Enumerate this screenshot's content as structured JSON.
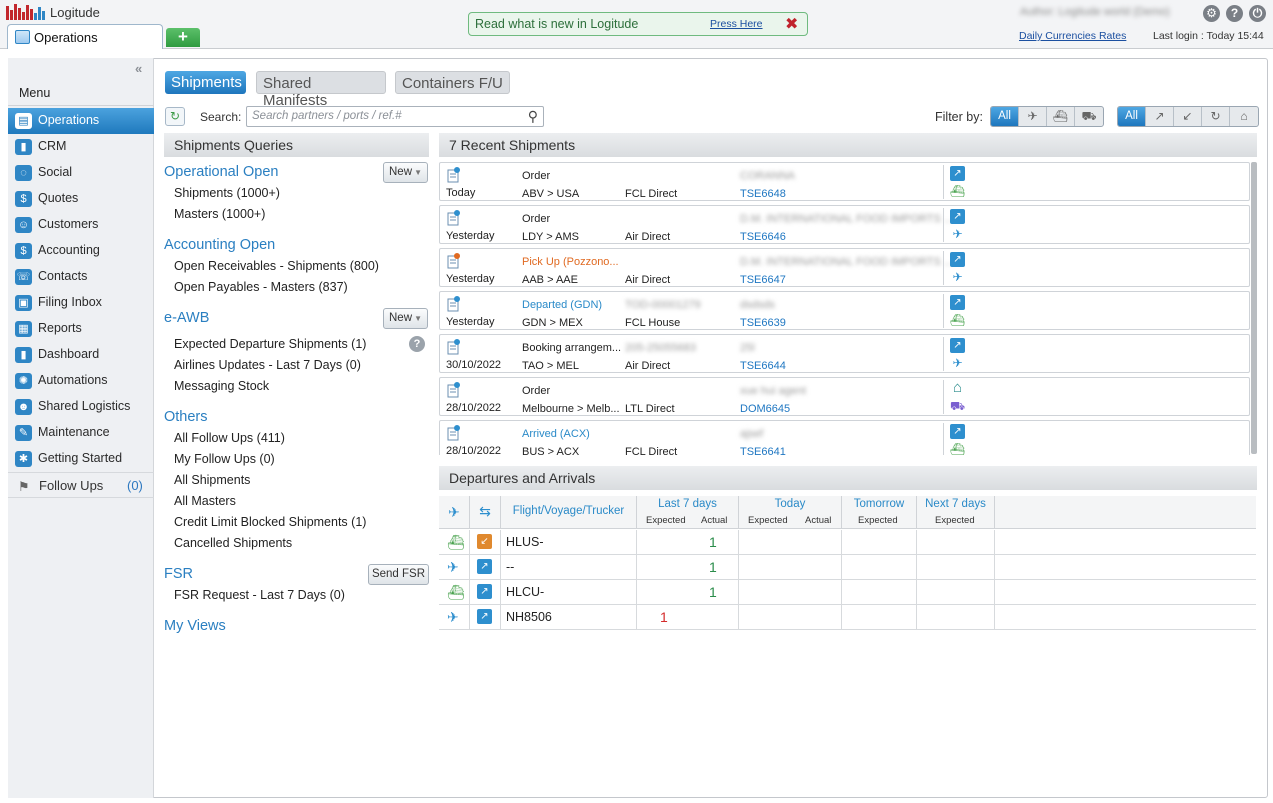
{
  "app": {
    "name": "Logitude",
    "tab": "Operations",
    "add_tab": "+"
  },
  "news": {
    "text": "Read what is new in Logitude",
    "link": "Press Here",
    "close": "✖"
  },
  "header": {
    "author": "Author: Logitude world (Demo)",
    "currencies": "Daily Currencies Rates",
    "last_login": "Last login : Today 15:44",
    "icons": [
      "gear-icon",
      "help-icon",
      "power-icon"
    ]
  },
  "sidebar": {
    "collapse": "«",
    "menu_title": "Menu",
    "items": [
      {
        "label": "Operations",
        "icon": "operations-icon",
        "color": "#2f86c5",
        "active": true
      },
      {
        "label": "CRM",
        "icon": "crm-icon",
        "color": "#2f86c5"
      },
      {
        "label": "Social",
        "icon": "social-icon",
        "color": "#2f86c5"
      },
      {
        "label": "Quotes",
        "icon": "quotes-icon",
        "color": "#2f86c5"
      },
      {
        "label": "Customers",
        "icon": "customers-icon",
        "color": "#2f86c5"
      },
      {
        "label": "Accounting",
        "icon": "accounting-icon",
        "color": "#2f86c5"
      },
      {
        "label": "Contacts",
        "icon": "contacts-icon",
        "color": "#2f86c5"
      },
      {
        "label": "Filing Inbox",
        "icon": "filing-inbox-icon",
        "color": "#2f86c5"
      },
      {
        "label": "Reports",
        "icon": "reports-icon",
        "color": "#2f86c5"
      },
      {
        "label": "Dashboard",
        "icon": "dashboard-icon",
        "color": "#2f86c5"
      },
      {
        "label": "Automations",
        "icon": "automations-icon",
        "color": "#2f86c5"
      },
      {
        "label": "Shared Logistics",
        "icon": "shared-logistics-icon",
        "color": "#2f86c5"
      },
      {
        "label": "Maintenance",
        "icon": "maintenance-icon",
        "color": "#2f86c5"
      },
      {
        "label": "Getting Started",
        "icon": "getting-started-icon",
        "color": "#2f86c5"
      }
    ],
    "follow_ups": {
      "label": "Follow Ups",
      "count": "(0)"
    }
  },
  "main_tabs": [
    "Shipments",
    "Shared Manifests",
    "Containers F/U"
  ],
  "search": {
    "label": "Search:",
    "placeholder": "Search partners / ports / ref.#"
  },
  "filter": {
    "label": "Filter by:",
    "all": "All"
  },
  "queries": {
    "title": "Shipments Queries",
    "new_label": "New",
    "send_fsr": "Send FSR",
    "groups": [
      {
        "title": "Operational Open",
        "items": [
          "Shipments (1000+)",
          "Masters (1000+)"
        ]
      },
      {
        "title": "Accounting Open",
        "items": [
          "Open Receivables - Shipments (800)",
          "Open Payables - Masters (837)"
        ]
      },
      {
        "title": "e-AWB",
        "items": [
          "Expected Departure Shipments (1)",
          "Airlines Updates - Last 7 Days (0)",
          "Messaging Stock"
        ]
      },
      {
        "title": "Others",
        "items": [
          "All Follow Ups (411)",
          "My Follow Ups (0)",
          "All Shipments",
          "All Masters",
          "Credit Limit Blocked Shipments (1)",
          "Cancelled Shipments"
        ]
      },
      {
        "title": "FSR",
        "items": [
          "FSR Request - Last 7 Days (0)"
        ]
      },
      {
        "title": "My Views",
        "items": []
      }
    ]
  },
  "recent": {
    "title": "7 Recent Shipments",
    "items": [
      {
        "date": "Today",
        "status": "Order",
        "status_style": "plain",
        "ref": "",
        "party": "CORANNA",
        "route": "ABV > USA",
        "mode": "FCL Direct",
        "number": "TSE6648",
        "dir": "export",
        "type": "ship"
      },
      {
        "date": "Yesterday",
        "status": "Order",
        "status_style": "plain",
        "ref": "",
        "party": "D.M. INTERNATIONAL FOOD IMPORTS ...",
        "route": "LDY > AMS",
        "mode": "Air Direct",
        "number": "TSE6646",
        "dir": "export",
        "type": "plane"
      },
      {
        "date": "Yesterday",
        "status": "Pick Up (Pozzono...",
        "status_style": "orange",
        "ref": "",
        "party": "D.M. INTERNATIONAL FOOD IMPORTS ...",
        "route": "AAB > AAE",
        "mode": "Air Direct",
        "number": "TSE6647",
        "dir": "export",
        "type": "plane"
      },
      {
        "date": "Yesterday",
        "status": "Departed (GDN)",
        "status_style": "blue",
        "ref": "TOD-00001279",
        "party": "dsdsds",
        "route": "GDN > MEX",
        "mode": "FCL House",
        "number": "TSE6639",
        "dir": "export",
        "type": "ship"
      },
      {
        "date": "30/10/2022",
        "status": "Booking arrangem...",
        "status_style": "plain",
        "ref": "205-25055683",
        "party": "25l",
        "route": "TAO > MEL",
        "mode": "Air Direct",
        "number": "TSE6644",
        "dir": "export",
        "type": "plane"
      },
      {
        "date": "28/10/2022",
        "status": "Order",
        "status_style": "plain",
        "ref": "",
        "party": "xue hui agent",
        "route": "Melbourne > Melb...",
        "mode": "LTL Direct",
        "number": "DOM6645",
        "dir": "home",
        "type": "truck"
      },
      {
        "date": "28/10/2022",
        "status": "Arrived (ACX)",
        "status_style": "blue",
        "ref": "",
        "party": "ajsef",
        "route": "BUS > ACX",
        "mode": "FCL Direct",
        "number": "TSE6641",
        "dir": "export",
        "type": "ship"
      }
    ]
  },
  "departures": {
    "title": "Departures and Arrivals",
    "columns": {
      "flight": "Flight/Voyage/Trucker",
      "last7": "Last 7 days",
      "today": "Today",
      "tomorrow": "Tomorrow",
      "next7": "Next 7 days",
      "expected": "Expected",
      "actual": "Actual"
    },
    "rows": [
      {
        "type": "ship",
        "dir": "import",
        "name": "HLUS-",
        "last7_expected": "",
        "last7_actual": "1"
      },
      {
        "type": "plane",
        "dir": "export",
        "name": "--",
        "last7_expected": "",
        "last7_actual": "1"
      },
      {
        "type": "ship",
        "dir": "export",
        "name": "HLCU-",
        "last7_expected": "",
        "last7_actual": "1"
      },
      {
        "type": "plane",
        "dir": "export",
        "name": "NH8506",
        "last7_expected": "1",
        "last7_actual": ""
      }
    ]
  }
}
